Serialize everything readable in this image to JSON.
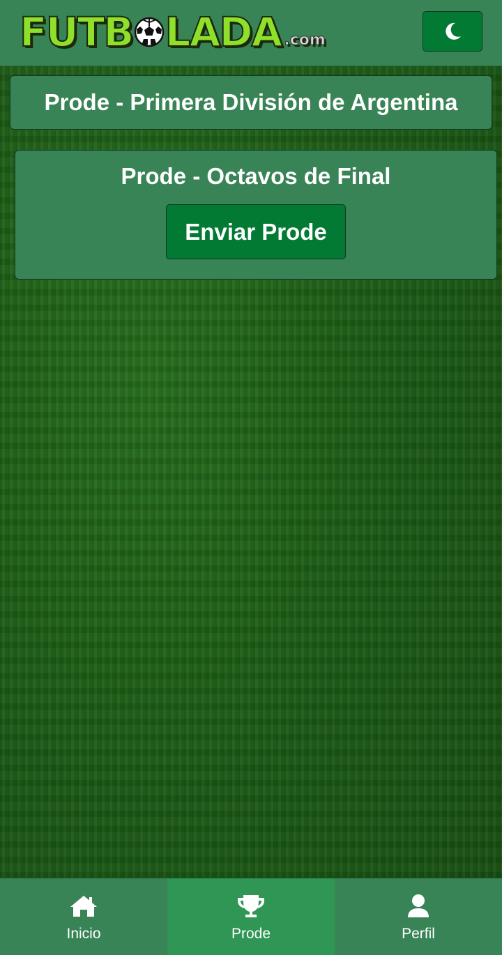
{
  "header": {
    "logo_text_left": "FUTB",
    "logo_text_right": "LADA",
    "logo_suffix": ".com",
    "theme_icon": "moon-icon"
  },
  "main": {
    "title": "Prode - Primera División de Argentina",
    "round": {
      "title": "Prode - Octavos de Final",
      "button_label": "Enviar Prode"
    }
  },
  "bottom_nav": {
    "items": [
      {
        "label": "Inicio",
        "icon": "home-icon",
        "active": false
      },
      {
        "label": "Prode",
        "icon": "trophy-icon",
        "active": true
      },
      {
        "label": "Perfil",
        "icon": "user-icon",
        "active": false
      }
    ]
  },
  "colors": {
    "header_bg": "#388456",
    "card_bg": "#388456",
    "button_bg": "#027a34",
    "nav_active_bg": "#2f9655",
    "logo_green": "#8ee02a",
    "field_bg": "#1b5e16"
  }
}
